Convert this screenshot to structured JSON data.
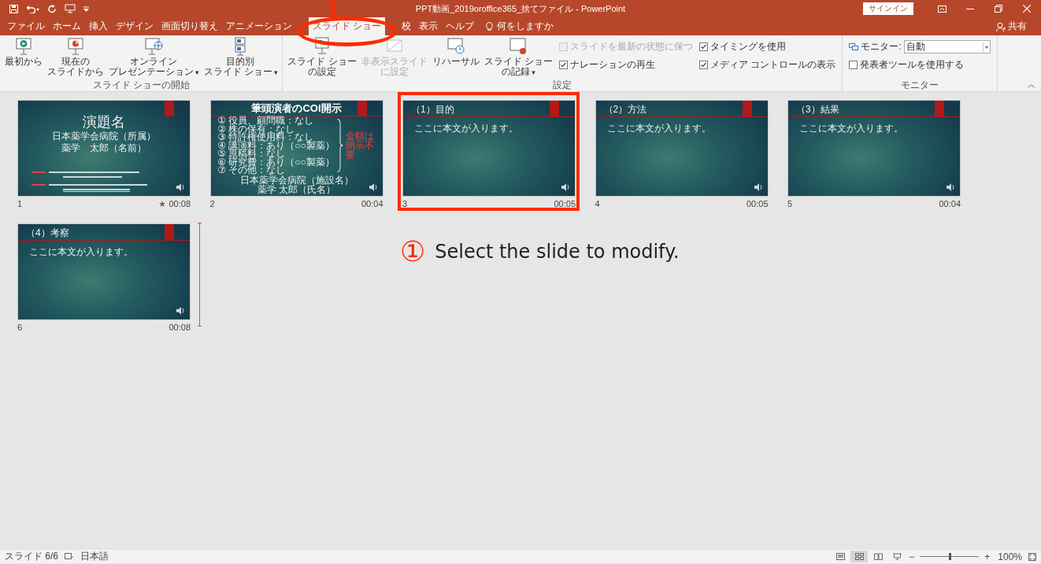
{
  "window": {
    "title": "PPT動画_2019oroffice365_捨てファイル - PowerPoint",
    "sign_in": "サインイン",
    "share": "共有"
  },
  "tabs": [
    {
      "label": "ファイル",
      "selected": false
    },
    {
      "label": "ホーム",
      "selected": false
    },
    {
      "label": "挿入",
      "selected": false
    },
    {
      "label": "デザイン",
      "selected": false
    },
    {
      "label": "画面切り替え",
      "selected": false
    },
    {
      "label": "アニメーション",
      "selected": false
    },
    {
      "label": "スライド ショー",
      "selected": true
    },
    {
      "label": "校",
      "selected": false
    },
    {
      "label": "表示",
      "selected": false
    },
    {
      "label": "ヘルプ",
      "selected": false
    }
  ],
  "tell_me": "何をしますか",
  "ribbon": {
    "groups": [
      {
        "label": "スライド ショーの開始",
        "buttons": [
          {
            "kind": "from-start",
            "lines": [
              "最初から"
            ],
            "disabled": false
          },
          {
            "kind": "from-current",
            "lines": [
              "現在の",
              "スライドから"
            ],
            "disabled": false
          },
          {
            "kind": "online",
            "lines": [
              "オンライン",
              "プレゼンテーション"
            ],
            "dropdown": "▾",
            "disabled": false
          },
          {
            "kind": "custom",
            "lines": [
              "目的別",
              "スライド ショー"
            ],
            "dropdown": "▾",
            "disabled": false
          }
        ]
      },
      {
        "label": "設定",
        "buttons": [
          {
            "kind": "setup",
            "lines": [
              "スライド ショー",
              "の設定"
            ],
            "disabled": false
          },
          {
            "kind": "hide",
            "lines": [
              "非表示スライド",
              "に設定"
            ],
            "disabled": true
          },
          {
            "kind": "rehearse",
            "lines": [
              "リハーサル"
            ],
            "disabled": false
          },
          {
            "kind": "record",
            "lines": [
              "スライド ショー",
              "の記録"
            ],
            "dropdown": "▾",
            "disabled": false
          }
        ],
        "checkboxes": [
          {
            "label": "スライドを最新の状態に保つ",
            "checked": false,
            "disabled": true
          },
          {
            "label": "ナレーションの再生",
            "checked": true,
            "disabled": false
          },
          {
            "label": "タイミングを使用",
            "checked": true,
            "disabled": false
          },
          {
            "label": "メディア コントロールの表示",
            "checked": true,
            "disabled": false
          }
        ]
      },
      {
        "label": "モニター",
        "monitor": {
          "label": "モニター:",
          "value": "自動"
        },
        "checkboxes": [
          {
            "label": "発表者ツールを使用する",
            "checked": false,
            "disabled": false
          }
        ]
      }
    ]
  },
  "slides": [
    {
      "kind": "title",
      "number": "1",
      "time": "00:08",
      "animated": true,
      "title": "演題名",
      "lines": [
        "日本薬学会病院（所属）",
        "薬学　太郎（名前）"
      ]
    },
    {
      "kind": "coi",
      "number": "2",
      "time": "00:04",
      "title": "筆頭演者のCOI開示",
      "items": [
        "① 役員、顧問職：なし",
        "② 株の保有：なし",
        "③ 特許権使用料：なし",
        "④ 講演料：あり（○○製薬）",
        "⑤ 原稿料：なし",
        "⑥ 研究費：あり（○○製薬）",
        "⑦ その他：なし"
      ],
      "note": "金額は開示不要",
      "footer": [
        "日本薬学会病院（施設名）",
        "薬学 太郎（氏名）"
      ]
    },
    {
      "kind": "content",
      "number": "3",
      "time": "00:05",
      "title": "（1）目的",
      "body": "ここに本文が入ります。"
    },
    {
      "kind": "content",
      "number": "4",
      "time": "00:05",
      "title": "（2）方法",
      "body": "ここに本文が入ります。"
    },
    {
      "kind": "content",
      "number": "5",
      "time": "00:04",
      "title": "（3）結果",
      "body": "ここに本文が入ります。"
    },
    {
      "kind": "content",
      "number": "6",
      "time": "00:08",
      "title": "（4）考察",
      "body": "ここに本文が入ります。"
    }
  ],
  "annotation": {
    "number": "①",
    "text": "Select the slide to modify."
  },
  "status_bar": {
    "slide": "スライド 6/6",
    "language": "日本語",
    "views": [
      {
        "kind": "normal",
        "selected": false
      },
      {
        "kind": "sorter",
        "selected": true
      },
      {
        "kind": "reading",
        "selected": false
      },
      {
        "kind": "slideshow",
        "selected": false
      }
    ],
    "zoom_out": "−",
    "zoom_slider": {
      "level": 0.5
    },
    "zoom_in": "+",
    "zoom": "100%"
  }
}
